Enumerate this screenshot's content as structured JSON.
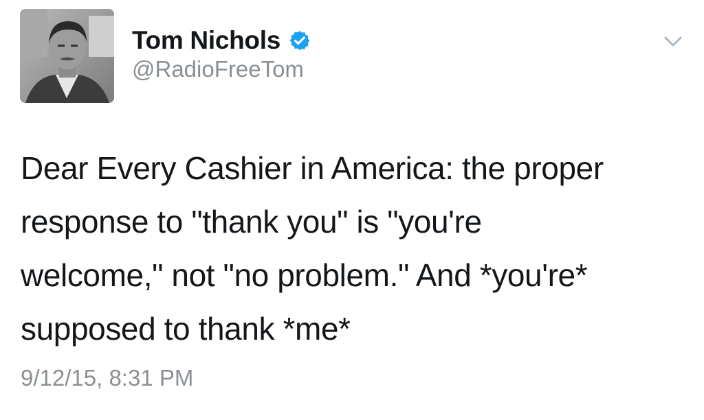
{
  "author": {
    "display_name": "Tom Nichols",
    "handle": "@RadioFreeTom",
    "verified": true,
    "verified_color": "#1da1f2"
  },
  "tweet": {
    "text_lines": [
      "Dear Every Cashier in America: the proper",
      "response to \"thank you\" is \"you're",
      "welcome,\" not \"no problem.\" And *you're*",
      "supposed to thank *me*"
    ],
    "timestamp": "9/12/15, 8:31 PM"
  },
  "icons": {
    "avatar": "profile-photo",
    "verified": "verified-badge-icon",
    "menu": "chevron-down-icon"
  }
}
